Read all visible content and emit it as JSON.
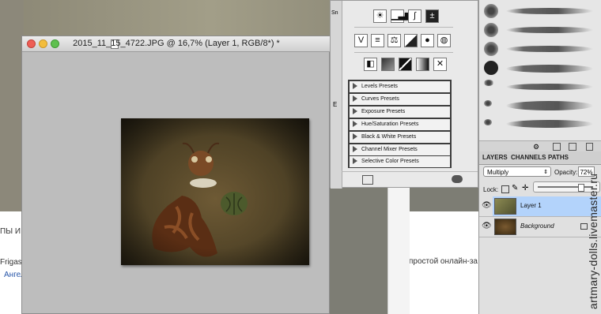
{
  "document": {
    "title": "2015_11_15_4722.JPG @ 16,7% (Layer 1, RGB/8*) *"
  },
  "background_page": {
    "left_snippets": [
      "ПЫ И",
      "Frigas",
      "Ангел"
    ],
    "right_snippet": "простой онлайн-за"
  },
  "adjustments": {
    "icons_row1": [
      "brightness-contrast-icon",
      "levels-icon",
      "curves-icon",
      "exposure-icon"
    ],
    "icons_row2": [
      "vibrance-icon",
      "hue-saturation-icon",
      "color-balance-icon",
      "black-white-icon",
      "photo-filter-icon",
      "channel-mixer-icon"
    ],
    "icons_row3": [
      "invert-icon",
      "posterize-icon",
      "threshold-icon",
      "gradient-map-icon",
      "selective-color-icon"
    ],
    "presets": [
      "Levels Presets",
      "Curves Presets",
      "Exposure Presets",
      "Hue/Saturation Presets",
      "Black & White Presets",
      "Channel Mixer Presets",
      "Selective Color Presets"
    ],
    "strip_fragments": [
      "Sn",
      "E"
    ]
  },
  "layers_panel": {
    "tabs": [
      "LAYERS",
      "CHANNELS",
      "PATHS"
    ],
    "blend_mode": "Multiply",
    "opacity_label": "Opacity:",
    "opacity_value": "72%",
    "lock_label": "Lock:",
    "layers": [
      {
        "name": "Layer 1",
        "selected": true
      },
      {
        "name": "Background",
        "selected": false
      }
    ],
    "selected_color": "#b3d3fb"
  },
  "watermark": "artmary-dolls.livemaster.ru"
}
